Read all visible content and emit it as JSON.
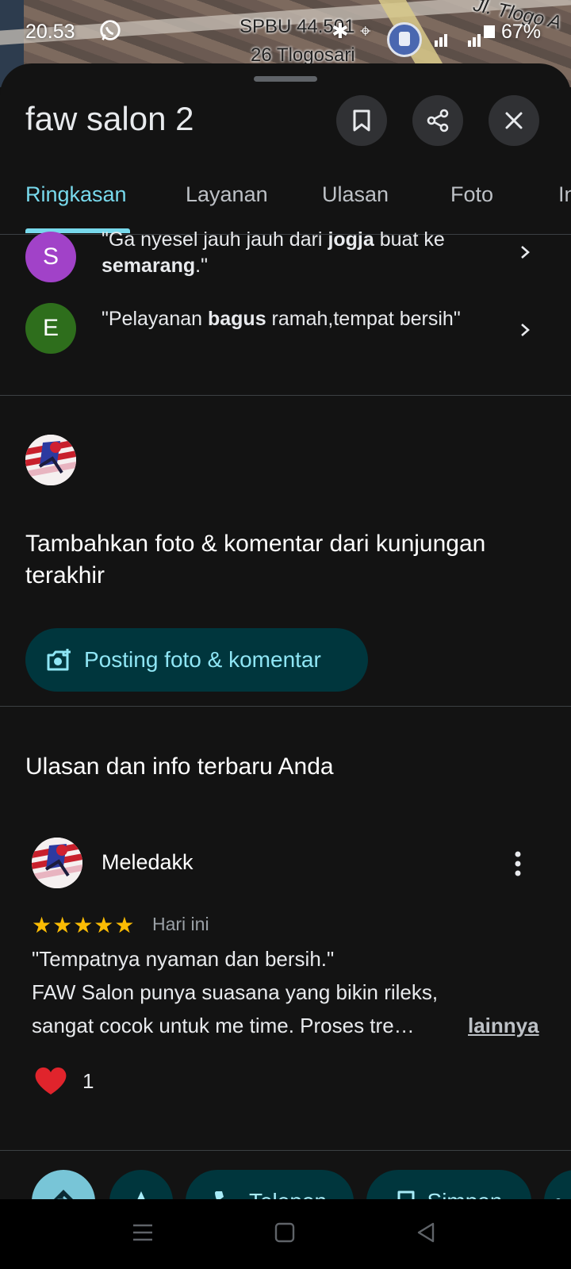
{
  "status_bar": {
    "time": "20.53",
    "battery": "67%",
    "map_label_1": "SPBU 44.501",
    "map_label_2": "26 Tlogosari",
    "map_label_3": "Jl. Tlogo A"
  },
  "place": {
    "title": "faw salon 2"
  },
  "header_buttons": {
    "save_icon": "bookmark-icon",
    "share_icon": "share-icon",
    "close_icon": "close-icon"
  },
  "tabs": [
    {
      "label": "Ringkasan",
      "active": true
    },
    {
      "label": "Layanan"
    },
    {
      "label": "Ulasan"
    },
    {
      "label": "Foto"
    },
    {
      "label": "In"
    }
  ],
  "snippets": [
    {
      "avatar_letter": "S",
      "avatar_color": "#a142c8",
      "text_html_parts": [
        "\"Ga nyesel jauh jauh dari ",
        "jogja",
        " buat ke ",
        "semarang",
        ".\""
      ]
    },
    {
      "avatar_letter": "E",
      "avatar_color": "#2e6e1c",
      "text_html_parts": [
        "\"Pelayanan ",
        "bagus",
        " ramah,tempat bersih\""
      ]
    }
  ],
  "add_section": {
    "heading": "Tambahkan foto & komentar dari kunjungan terakhir",
    "button_label": "Posting foto & komentar"
  },
  "recent_section": {
    "title": "Ulasan dan info terbaru Anda"
  },
  "review": {
    "name": "Meledakk",
    "stars": "★★★★★",
    "rating": 5,
    "date": "Hari ini",
    "line1": "\"Tempatnya nyaman dan bersih.\"",
    "line2": "FAW Salon punya suasana yang bikin rileks,",
    "line3": "sangat cocok untuk me time. Proses tre…",
    "more": "lainnya",
    "likes": "1"
  },
  "actions": {
    "directions_icon": "directions-icon",
    "start_icon": "navigation-arrow-icon",
    "call_label": "Telepon",
    "save_label": "Simpan"
  },
  "colors": {
    "accent": "#78d9ec",
    "chip_bg": "#00363d",
    "star": "#fbbc04"
  }
}
